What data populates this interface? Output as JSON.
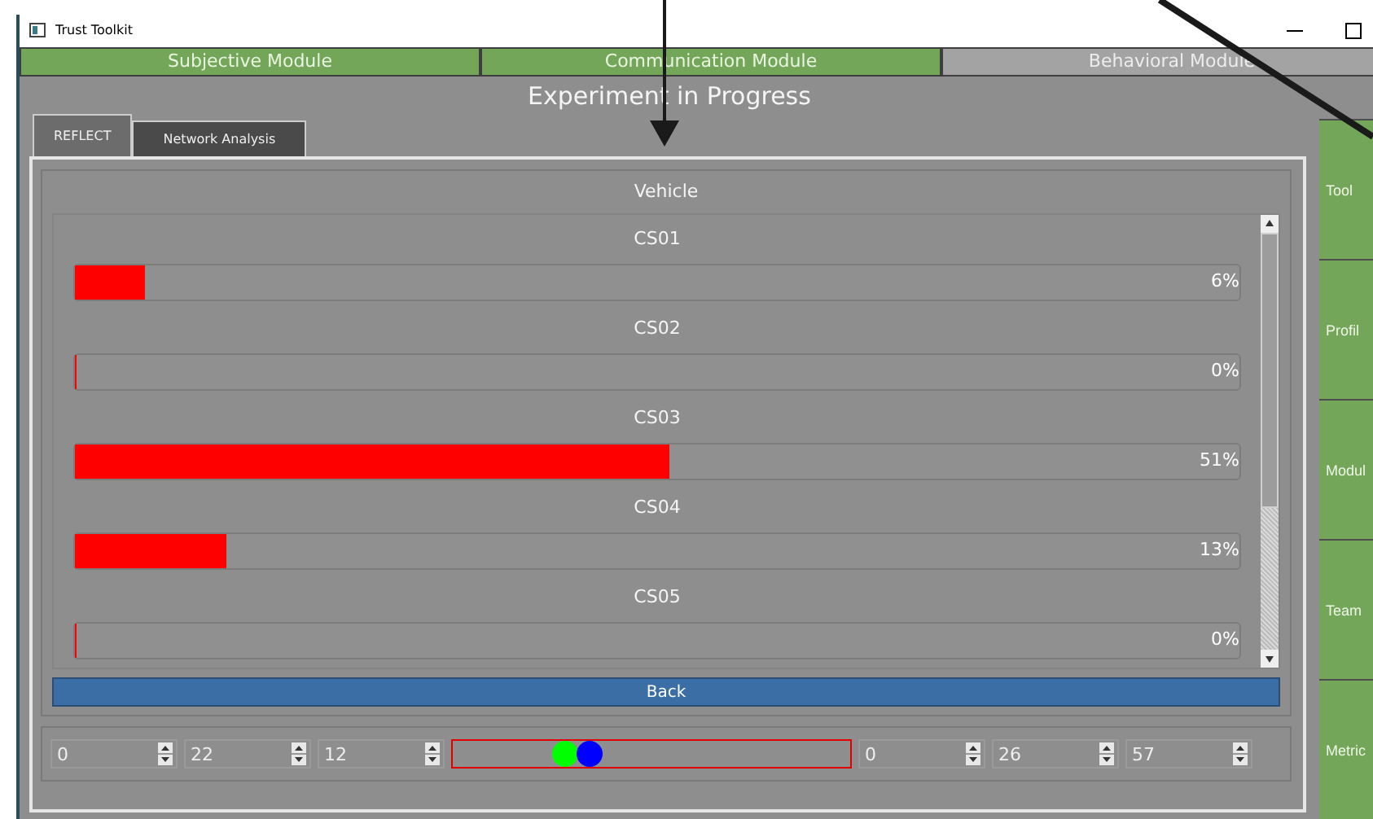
{
  "window": {
    "title": "Trust Toolkit"
  },
  "modules": [
    {
      "label": "Subjective Module",
      "disabled": false
    },
    {
      "label": "Communication Module",
      "disabled": false
    },
    {
      "label": "Behavioral Module",
      "disabled": true
    }
  ],
  "heading": "Experiment in Progress",
  "tabs": [
    {
      "label": "REFLECT",
      "selected": true
    },
    {
      "label": "Network Analysis",
      "selected": false
    }
  ],
  "group_title": "Vehicle",
  "channels": [
    {
      "name": "CS01",
      "level": 0.06,
      "reading": "6%"
    },
    {
      "name": "CS02",
      "level": 0,
      "reading": "0%"
    },
    {
      "name": "CS03",
      "level": 0.51,
      "reading": "51%"
    },
    {
      "name": "CS04",
      "level": 0.13,
      "reading": "13%"
    },
    {
      "name": "CS05",
      "level": 0,
      "reading": "0%"
    }
  ],
  "back_button": "Back",
  "start_time": [
    "0",
    "22",
    "12"
  ],
  "range": {
    "start_handle": {
      "level": 0.25
    },
    "end_handle": {
      "level": 0.31
    }
  },
  "end_time": [
    "0",
    "26",
    "57"
  ],
  "sidebar": [
    "Tool",
    "Profil",
    "Modul",
    "Team",
    "Metric"
  ]
}
